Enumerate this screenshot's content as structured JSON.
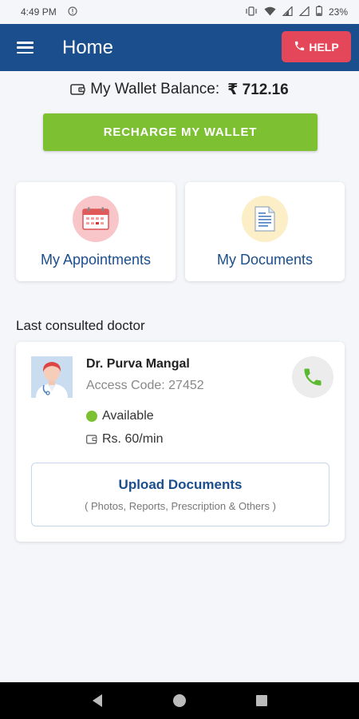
{
  "status_bar": {
    "time": "4:49 PM",
    "battery": "23%",
    "icons": [
      "alert-icon",
      "vibrate-icon",
      "wifi-icon",
      "signal-icon",
      "signal-icon",
      "battery-icon"
    ]
  },
  "app_bar": {
    "title": "Home",
    "help_label": "HELP",
    "colors": {
      "background": "#1b4e8c",
      "help": "#e4475a"
    }
  },
  "wallet": {
    "label": "My Wallet Balance:",
    "amount": "₹ 712.16",
    "recharge_label": "RECHARGE MY WALLET",
    "recharge_color": "#7dc133"
  },
  "tiles": [
    {
      "label": "My Appointments",
      "icon": "calendar-icon"
    },
    {
      "label": "My Documents",
      "icon": "document-icon"
    }
  ],
  "last_consulted": {
    "heading": "Last consulted doctor",
    "doctor": {
      "name": "Dr. Purva Mangal",
      "access_code": "Access Code: 27452",
      "status": "Available",
      "rate": "Rs. 60/min"
    },
    "upload": {
      "title": "Upload Documents",
      "subtitle": "( Photos, Reports, Prescription & Others )"
    }
  },
  "nav_bar": {
    "buttons": [
      "back-icon",
      "home-icon",
      "recents-icon"
    ]
  }
}
